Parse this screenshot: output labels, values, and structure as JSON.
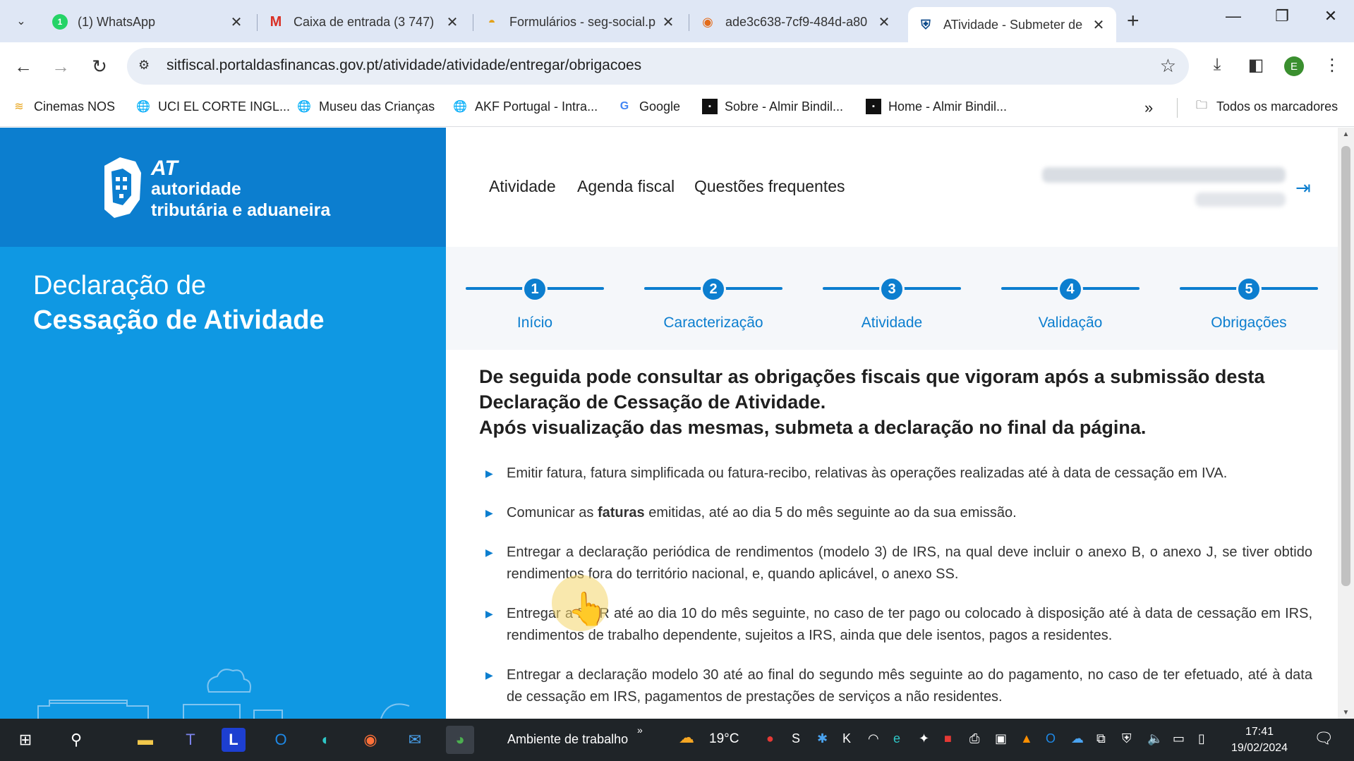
{
  "browser": {
    "tabs": [
      {
        "title": "(1) WhatsApp",
        "favicon": "whatsapp-icon",
        "active": false
      },
      {
        "title": "Caixa de entrada (3 747)",
        "favicon": "gmail-icon",
        "active": false
      },
      {
        "title": "Formulários - seg-social.p",
        "favicon": "seg-social-icon",
        "active": false
      },
      {
        "title": "ade3c638-7cf9-484d-a80",
        "favicon": "file-icon",
        "active": false
      },
      {
        "title": "ATividade - Submeter de",
        "favicon": "at-icon",
        "active": true
      }
    ],
    "url": "sitfiscal.portaldasfinancas.gov.pt/atividade/atividade/entregar/obrigacoes",
    "profile_initial": "E",
    "bookmarks": [
      {
        "label": "Cinemas NOS",
        "icon": "nos-icon"
      },
      {
        "label": "UCI EL CORTE INGL...",
        "icon": "globe-icon"
      },
      {
        "label": "Museu das Crianças",
        "icon": "globe-icon"
      },
      {
        "label": "AKF Portugal - Intra...",
        "icon": "globe-icon"
      },
      {
        "label": "Google",
        "icon": "google-icon"
      },
      {
        "label": "Sobre - Almir Bindil...",
        "icon": "page-icon"
      },
      {
        "label": "Home - Almir Bindil...",
        "icon": "page-icon"
      }
    ],
    "all_bookmarks": "Todos os marcadores"
  },
  "site": {
    "logo": {
      "at": "AT",
      "line2": "autoridade",
      "line3": "tributária e aduaneira"
    },
    "left_title": {
      "line1": "Declaração de",
      "line2": "Cessação de Atividade"
    },
    "nav": [
      "Atividade",
      "Agenda fiscal",
      "Questões frequentes"
    ],
    "steps": [
      {
        "num": "1",
        "label": "Início"
      },
      {
        "num": "2",
        "label": "Caracterização"
      },
      {
        "num": "3",
        "label": "Atividade"
      },
      {
        "num": "4",
        "label": "Validação"
      },
      {
        "num": "5",
        "label": "Obrigações"
      }
    ],
    "intro": {
      "line1": "De seguida pode consultar as obrigações fiscais que vigoram após a submissão desta Declaração de Cessação de Atividade.",
      "line2": "Após visualização das mesmas, submeta a declaração no final da página."
    },
    "obligations": [
      {
        "pre": "Emitir fatura, fatura simplificada ou fatura-recibo, relativas às operações realizadas até à data de cessação em IVA.",
        "bold": "",
        "post": ""
      },
      {
        "pre": "Comunicar as ",
        "bold": "faturas",
        "post": " emitidas, até ao dia 5 do mês seguinte ao da sua emissão."
      },
      {
        "pre": "Entregar a declaração periódica de rendimentos (modelo 3) de IRS, na qual deve incluir o anexo B, o anexo J, se tiver obtido rendimentos fora do território nacional, e, quando aplicável, o anexo SS.",
        "bold": "",
        "post": ""
      },
      {
        "pre": "Entregar a DMR até ao dia 10 do mês seguinte, no caso de ter pago ou colocado à disposição até à data de cessação em IRS, rendimentos de trabalho dependente, sujeitos a IRS, ainda que dele isentos, pagos a residentes.",
        "bold": "",
        "post": ""
      },
      {
        "pre": "Entregar a declaração modelo 30 até ao final do segundo mês seguinte ao do pagamento, no caso de ter efetuado, até à data de cessação em IRS, pagamentos de prestações de serviços a não residentes.",
        "bold": "",
        "post": ""
      }
    ]
  },
  "taskbar": {
    "workspace_label": "Ambiente de trabalho",
    "temperature": "19°C",
    "time": "17:41",
    "date": "19/02/2024"
  },
  "colors": {
    "brand": "#0c7ecf",
    "left_panel": "#0f98e3"
  }
}
